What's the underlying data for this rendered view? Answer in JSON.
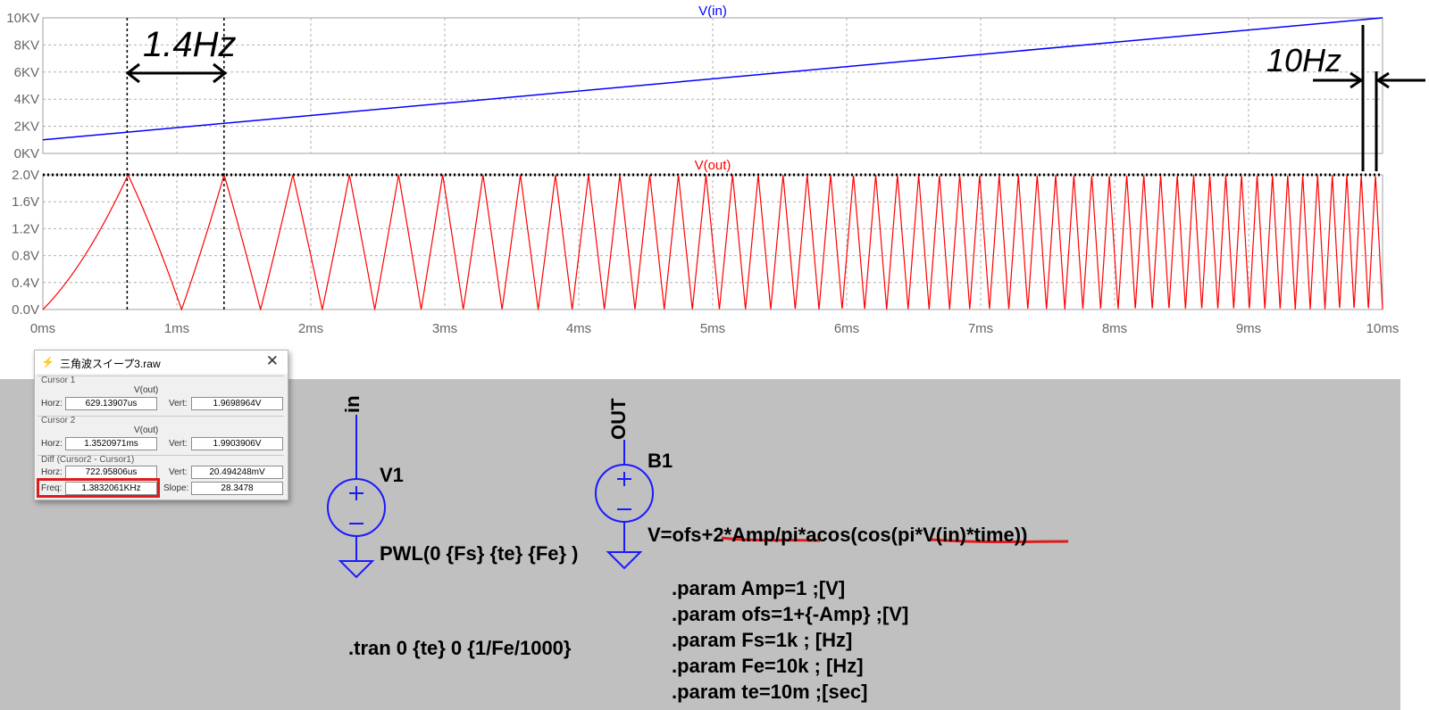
{
  "plot": {
    "top_pane": {
      "trace_label": "V(in)",
      "y_ticks": [
        "10KV",
        "8KV",
        "6KV",
        "4KV",
        "2KV",
        "0KV"
      ],
      "trace_color": "#0000ff"
    },
    "bottom_pane": {
      "trace_label": "V(out)",
      "y_ticks": [
        "2.0V",
        "1.6V",
        "1.2V",
        "0.8V",
        "0.4V",
        "0.0V"
      ],
      "trace_color": "#ff0000"
    },
    "x_ticks": [
      "0ms",
      "1ms",
      "2ms",
      "3ms",
      "4ms",
      "5ms",
      "6ms",
      "7ms",
      "8ms",
      "9ms",
      "10ms"
    ],
    "annotations": {
      "left": "1.4Hz",
      "right": "10Hz"
    }
  },
  "chart_data": [
    {
      "type": "line",
      "title": "V(in)",
      "xlabel": "",
      "ylabel": "",
      "xlim_ms": [
        0,
        10
      ],
      "ylim_kv": [
        0,
        10
      ],
      "series": [
        {
          "name": "V(in)",
          "x_ms": [
            0,
            10
          ],
          "y_kv": [
            1,
            10
          ]
        }
      ],
      "grid": true
    },
    {
      "type": "line",
      "title": "V(out)",
      "xlabel": "",
      "ylabel": "",
      "xlim_ms": [
        0,
        10
      ],
      "ylim_v": [
        0,
        2
      ],
      "series": [
        {
          "name": "V(out)",
          "description_values": "triangle wave swept from 1kHz to 10kHz, amplitude 0..2V"
        }
      ],
      "sweep": {
        "f_start_hz": 1000,
        "f_end_hz": 10000,
        "t_end_ms": 10
      },
      "grid": true
    }
  ],
  "cursor_window": {
    "title": "三角波スイープ3.raw",
    "cursor1": {
      "label": "Cursor 1",
      "trace": "V(out)",
      "horz_label": "Horz:",
      "horz": "629.13907us",
      "vert_label": "Vert:",
      "vert": "1.9698964V"
    },
    "cursor2": {
      "label": "Cursor 2",
      "trace": "V(out)",
      "horz_label": "Horz:",
      "horz": "1.3520971ms",
      "vert_label": "Vert:",
      "vert": "1.9903906V"
    },
    "diff": {
      "label": "Diff (Cursor2 - Cursor1)",
      "horz_label": "Horz:",
      "horz": "722.95806us",
      "vert_label": "Vert:",
      "vert": "20.494248mV",
      "freq_label": "Freq:",
      "freq": "1.3832061KHz",
      "slope_label": "Slope:",
      "slope": "28.3478"
    }
  },
  "schematic": {
    "net_in": "in",
    "net_out": "OUT",
    "v1_name": "V1",
    "v1_value": "PWL(0 {Fs}  {te} {Fe} )",
    "b1_name": "B1",
    "b1_value": "V=ofs+2*Amp/pi*acos(cos(pi*V(in)*time))",
    "tran": ".tran 0 {te} 0 {1/Fe/1000}",
    "params": [
      ".param Amp=1 ;[V]",
      ".param ofs=1+{-Amp} ;[V]",
      ".param Fs=1k ; [Hz]",
      ".param Fe=10k ; [Hz]",
      ".param te=10m ;[sec]"
    ]
  }
}
